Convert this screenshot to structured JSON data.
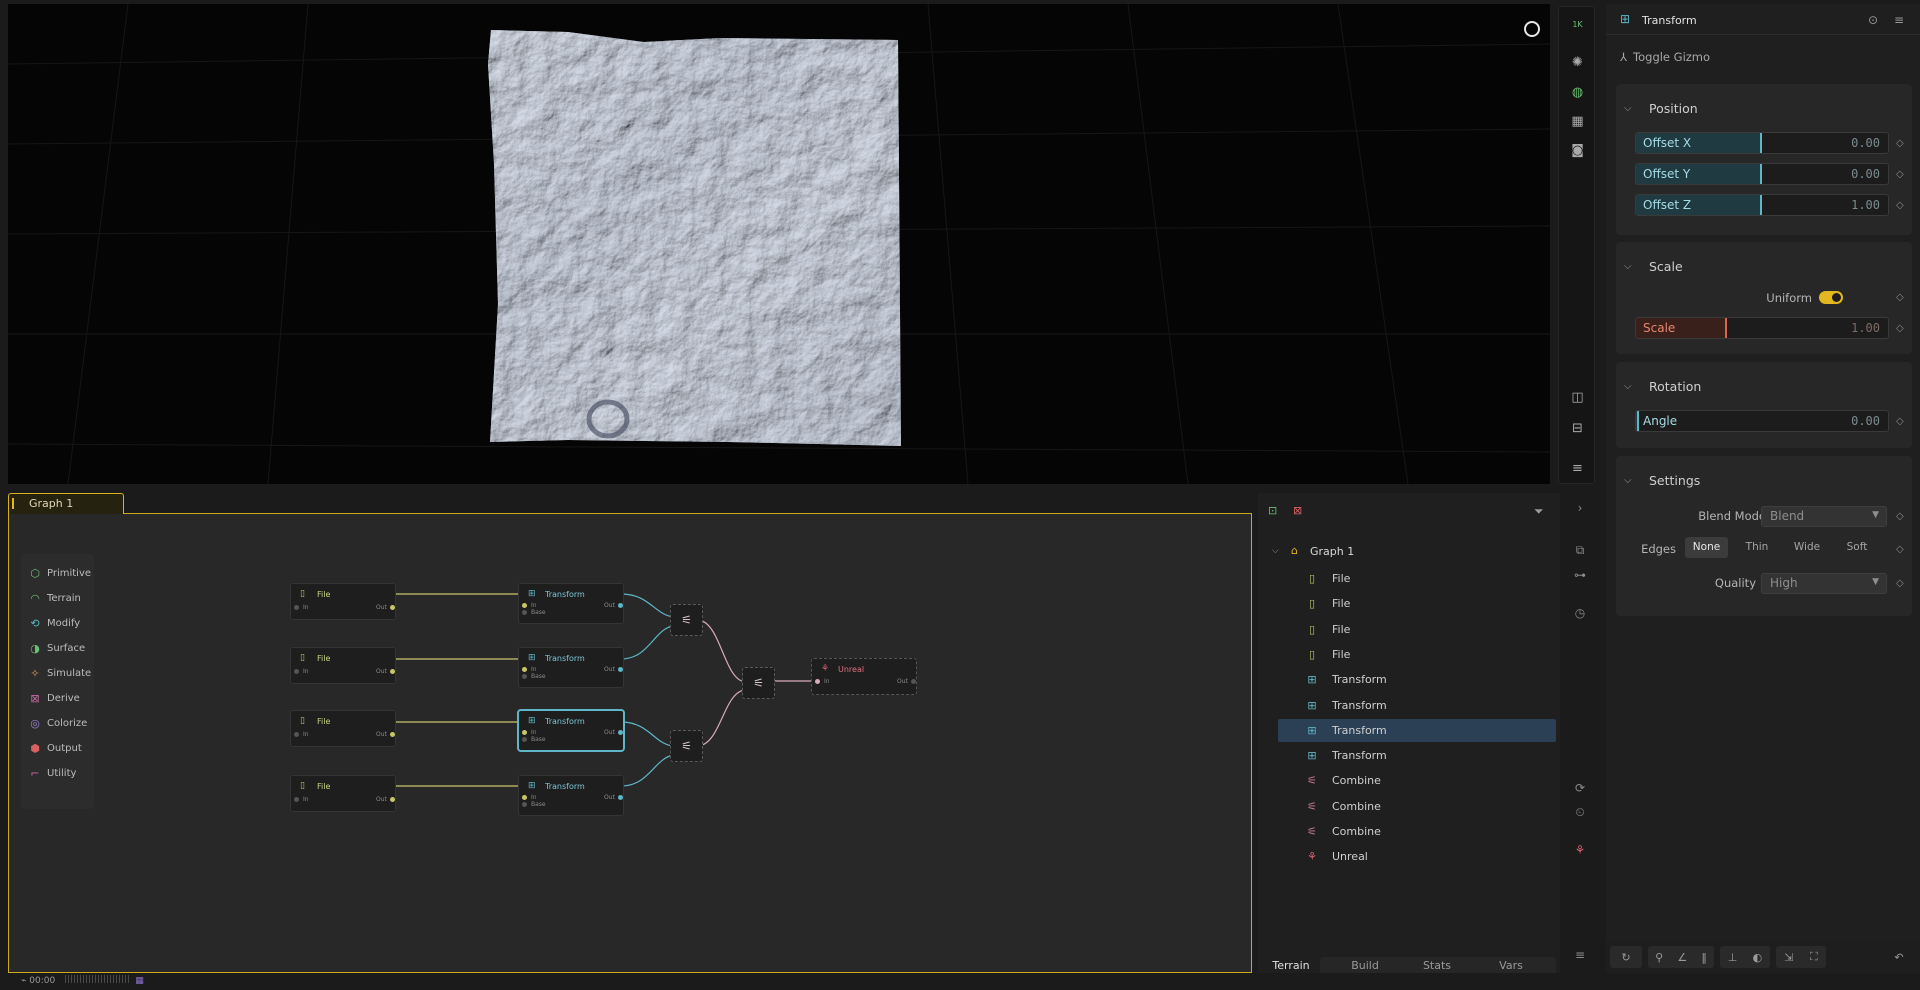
{
  "viewport": {
    "toolbar": {
      "resolution_label": "1K",
      "icons": [
        "sun-icon",
        "globe-icon",
        "grid-icon",
        "camera-icon",
        "split-view-icon",
        "layout-icon",
        "menu-icon"
      ]
    }
  },
  "properties": {
    "node_title": "Transform",
    "toggle_gizmo": "Toggle Gizmo",
    "position": {
      "header": "Position",
      "offset_x": {
        "label": "Offset X",
        "value": "0.00"
      },
      "offset_y": {
        "label": "Offset Y",
        "value": "0.00"
      },
      "offset_z": {
        "label": "Offset Z",
        "value": "1.00"
      }
    },
    "scale": {
      "header": "Scale",
      "uniform_label": "Uniform",
      "uniform_on": true,
      "scale_field": {
        "label": "Scale",
        "value": "1.00"
      }
    },
    "rotation": {
      "header": "Rotation",
      "angle": {
        "label": "Angle",
        "value": "0.00"
      }
    },
    "settings": {
      "header": "Settings",
      "blend_mode_label": "Blend Mode",
      "blend_mode_value": "Blend",
      "edges_label": "Edges",
      "edges_options": [
        "None",
        "Thin",
        "Wide",
        "Soft"
      ],
      "edges_selected": "None",
      "quality_label": "Quality",
      "quality_value": "High"
    }
  },
  "graph": {
    "tab_label": "Graph 1",
    "palette": [
      {
        "label": "Primitive",
        "icon": "cube-icon",
        "color": "#6bbf73"
      },
      {
        "label": "Terrain",
        "icon": "terrain-icon",
        "color": "#6bbf73"
      },
      {
        "label": "Modify",
        "icon": "modify-icon",
        "color": "#5fb6c8"
      },
      {
        "label": "Surface",
        "icon": "surface-icon",
        "color": "#6bbf73"
      },
      {
        "label": "Simulate",
        "icon": "simulate-icon",
        "color": "#d79b55"
      },
      {
        "label": "Derive",
        "icon": "derive-icon",
        "color": "#c76aa5"
      },
      {
        "label": "Colorize",
        "icon": "palette-icon",
        "color": "#9d86d8"
      },
      {
        "label": "Output",
        "icon": "output-icon",
        "color": "#d96060"
      },
      {
        "label": "Utility",
        "icon": "utility-icon",
        "color": "#c76aa5"
      }
    ],
    "nodes": {
      "file_title": "File",
      "transform_title": "Transform",
      "unreal_title": "Unreal",
      "pin_in": "In",
      "pin_out": "Out",
      "pin_base": "Base"
    },
    "timer": "00:00"
  },
  "hierarchy": {
    "root": "Graph 1",
    "items": [
      {
        "label": "File",
        "icon": "file-icon",
        "color": "#b6c46a"
      },
      {
        "label": "File",
        "icon": "file-icon",
        "color": "#b6c46a"
      },
      {
        "label": "File",
        "icon": "file-icon",
        "color": "#b6c46a"
      },
      {
        "label": "File",
        "icon": "file-icon",
        "color": "#b6c46a"
      },
      {
        "label": "Transform",
        "icon": "transform-icon",
        "color": "#5fb6c8"
      },
      {
        "label": "Transform",
        "icon": "transform-icon",
        "color": "#5fb6c8"
      },
      {
        "label": "Transform",
        "icon": "transform-icon",
        "color": "#5fb6c8",
        "selected": true
      },
      {
        "label": "Transform",
        "icon": "transform-icon",
        "color": "#5fb6c8"
      },
      {
        "label": "Combine",
        "icon": "combine-icon",
        "color": "#c77a9c"
      },
      {
        "label": "Combine",
        "icon": "combine-icon",
        "color": "#c77a9c"
      },
      {
        "label": "Combine",
        "icon": "combine-icon",
        "color": "#c77a9c"
      },
      {
        "label": "Unreal",
        "icon": "unreal-icon",
        "color": "#d96070"
      }
    ],
    "tabs": [
      "Terrain",
      "Build",
      "Stats",
      "Vars"
    ],
    "active_tab": "Terrain"
  },
  "colors": {
    "accent": "#e2b720",
    "selection": "#2b3f55",
    "modify": "#5fb6c8",
    "scale": "#d9654b"
  }
}
